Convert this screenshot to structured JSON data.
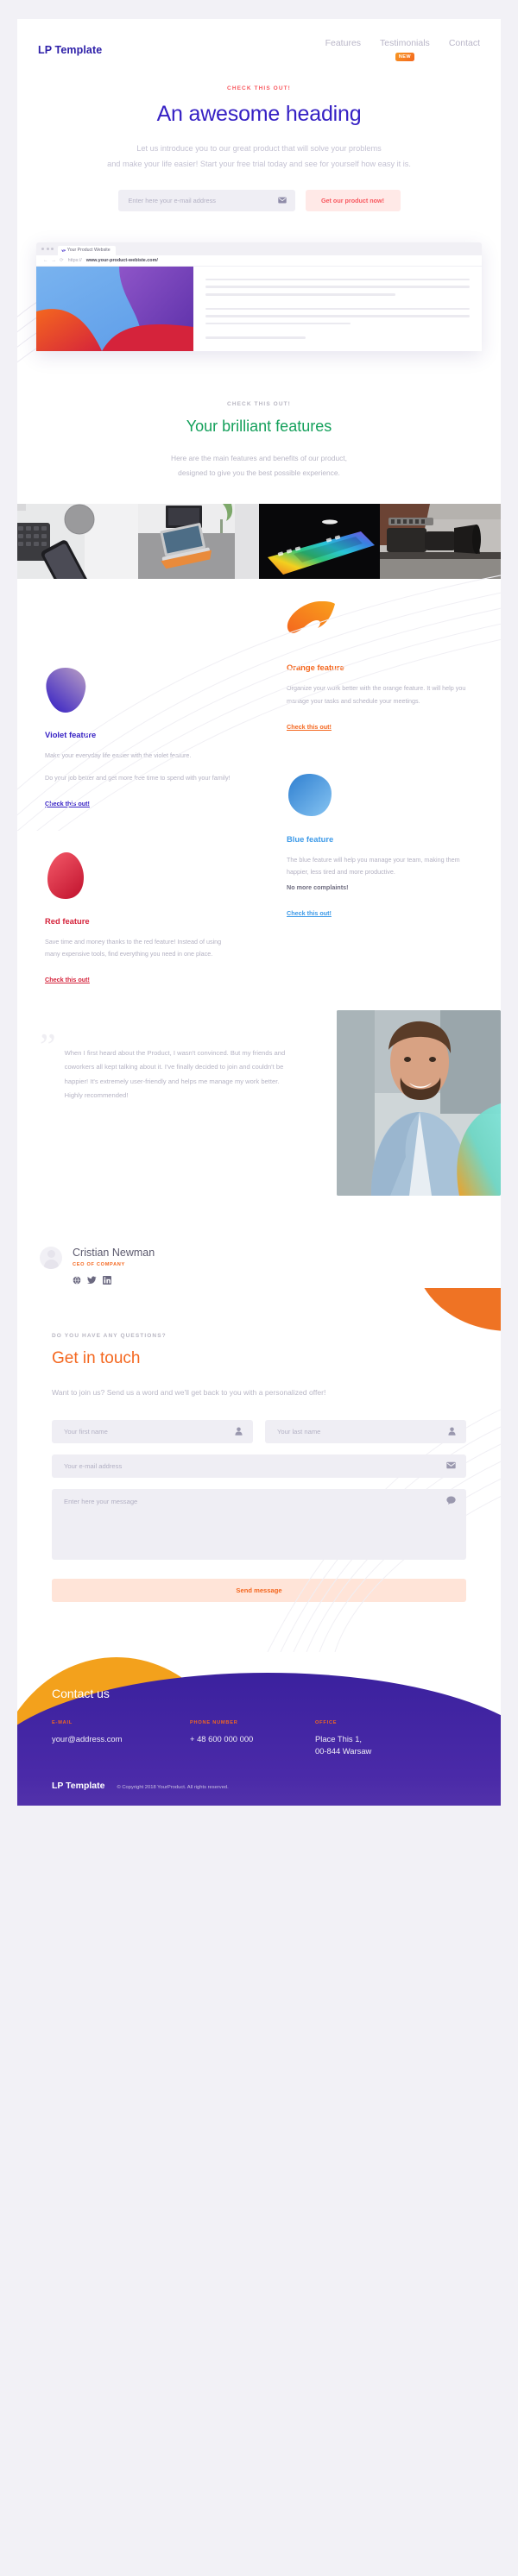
{
  "header": {
    "brand": "LP Template",
    "nav": [
      {
        "label": "Features",
        "badge": null
      },
      {
        "label": "Testimonials",
        "badge": "NEW"
      },
      {
        "label": "Contact",
        "badge": null
      }
    ]
  },
  "hero": {
    "eyebrow": "CHECK THIS OUT!",
    "heading": "An awesome heading",
    "lead_line1": "Let us introduce you to our great product that will solve your problems",
    "lead_line2": "and make your life easier! Start your free trial today and see for yourself how easy it is.",
    "email_placeholder": "Enter here your e-mail address",
    "email_value": "",
    "cta_label": "Get our product now!"
  },
  "browser": {
    "tab_title": "Your Product Website",
    "favicon_text": "YP",
    "url_protocol": "https://",
    "url_domain": "www.your-product-webiste.com/"
  },
  "features_head": {
    "eyebrow": "CHECK THIS OUT!",
    "heading": "Your brilliant features",
    "sub_line1": "Here are the main features and benefits of our product,",
    "sub_line2": "designed to give you the best possible experience."
  },
  "gallery": [
    {
      "name": "keyboard-and-phone-photo"
    },
    {
      "name": "laptop-desk-photo"
    },
    {
      "name": "rgb-keyboard-photo"
    },
    {
      "name": "camera-photo"
    }
  ],
  "features": [
    {
      "key": "violet",
      "title": "Violet feature",
      "color": "#3621c4",
      "paragraphs": [
        "Make your everyday life easier with the violet feature.",
        "Do your job better and get more free time to spend with your family!"
      ],
      "bold_note": null,
      "link": "Check this out!"
    },
    {
      "key": "orange",
      "title": "Orange feature",
      "color": "#f4671f",
      "paragraphs": [
        "Organize your work better with the orange feature. It will help you manage your tasks and schedule your meetings."
      ],
      "bold_note": null,
      "link": "Check this out!"
    },
    {
      "key": "blue",
      "title": "Blue feature",
      "color": "#3d9ae8",
      "paragraphs": [
        "The blue feature will help you manage your team, making them happier, less tired and more productive."
      ],
      "bold_note": "No more complaints!",
      "link": "Check this out!"
    },
    {
      "key": "red",
      "title": "Red feature",
      "color": "#d5233b",
      "paragraphs": [
        "Save time and money thanks to the red feature! Instead of using many expensive tools, find everything you need in one place."
      ],
      "bold_note": null,
      "link": "Check this out!"
    }
  ],
  "testimonial": {
    "quote_mark": "”",
    "quote": "When I first heard about the Product, I wasn't convinced. But my friends and coworkers all kept talking about it. I've finally decided to join and couldn't be happier! It's extremely user-friendly and helps me manage my work better. Highly recommended!",
    "author_name": "Cristian Newman",
    "author_role": "CEO OF COMPANY",
    "socials": [
      "globe-icon",
      "twitter-icon",
      "linkedin-icon"
    ]
  },
  "contact": {
    "eyebrow": "DO YOU HAVE ANY QUESTIONS?",
    "heading": "Get in touch",
    "intro": "Want to join us? Send us a word and we'll get back to you with a personalized offer!",
    "first_name_placeholder": "Your first name",
    "first_name_value": "",
    "last_name_placeholder": "Your last name",
    "last_name_value": "",
    "email_placeholder": "Your e-mail address",
    "email_value": "",
    "message_placeholder": "Enter here your message",
    "message_value": "",
    "send_label": "Send message"
  },
  "footer": {
    "title": "Contact us",
    "columns": [
      {
        "label": "E-MAIL",
        "value": "your@address.com"
      },
      {
        "label": "PHONE NUMBER",
        "value": "+ 48 600 000 000"
      },
      {
        "label": "OFFICE",
        "value": "Place This 1,\n00-844 Warsaw"
      }
    ],
    "brand": "LP Template",
    "copyright": "© Copyright 2018 YourProduct. All rights reserved."
  },
  "colors": {
    "brand_violet": "#3621c4",
    "accent_red": "#f8585f",
    "accent_orange": "#f4671f",
    "accent_green": "#14a05b",
    "accent_blue": "#3d9ae8",
    "page_bg": "#f2f1f6"
  }
}
